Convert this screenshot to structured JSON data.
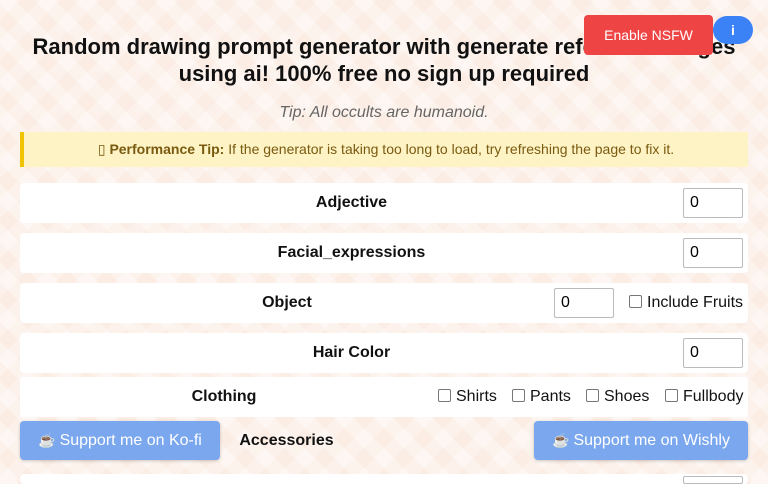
{
  "header": {
    "title": "Random drawing prompt generator with generate reference images using ai! 100% free no sign up required",
    "nsfw_button": "Enable NSFW",
    "info_button": "i"
  },
  "tip": "Tip: All occults are humanoid.",
  "performance_tip": {
    "icon": "lightbulb-icon",
    "label": "Performance Tip:",
    "text": "If the generator is taking too long to load, try refreshing the page to fix it."
  },
  "rows": {
    "adjective": {
      "label": "Adjective",
      "value": "0"
    },
    "facial_expressions": {
      "label": "Facial_expressions",
      "value": "0"
    },
    "object": {
      "label": "Object",
      "value": "0",
      "checkbox_label": "Include Fruits"
    },
    "hair_color": {
      "label": "Hair Color",
      "value": "0"
    },
    "clothing": {
      "label": "Clothing",
      "options": [
        "Shirts",
        "Pants",
        "Shoes",
        "Fullbody"
      ]
    },
    "accessories": {
      "label": "Accessories"
    }
  },
  "support": {
    "kofi": "Support me on Ko-fi",
    "wishly": "Support me on Wishly",
    "icon": "coffee-icon"
  },
  "colors": {
    "nsfw_button": "#ef4444",
    "info_button": "#3b82f6",
    "support_button": "#7aa7ee",
    "tip_background": "#fdf3c4",
    "tip_border": "#f0c400"
  }
}
